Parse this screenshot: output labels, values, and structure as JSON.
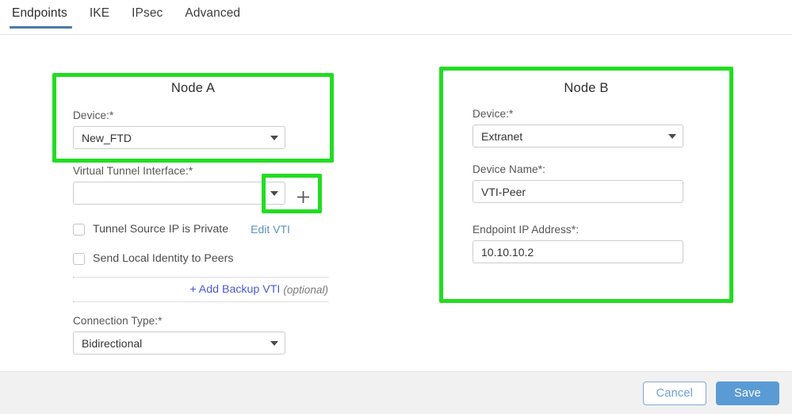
{
  "colors": {
    "tab_accent": "#4a7ba7",
    "highlight_green": "#22dd22",
    "link_blue": "#5b8fc9",
    "link_strong_blue": "#4a5bd0",
    "primary_button_bg": "#5b9bd5",
    "secondary_button_text": "#6c9fd8",
    "footer_bg": "#f1f1f1"
  },
  "tabs": [
    {
      "label": "Endpoints",
      "active": true
    },
    {
      "label": "IKE",
      "active": false
    },
    {
      "label": "IPsec",
      "active": false
    },
    {
      "label": "Advanced",
      "active": false
    }
  ],
  "node_a": {
    "title": "Node A",
    "device": {
      "label": "Device:*",
      "value": "New_FTD",
      "caret_icon": "chevron-down-icon"
    },
    "virtual_tunnel_interface": {
      "label": "Virtual Tunnel Interface:*",
      "value": "",
      "placeholder": "",
      "caret_icon": "chevron-down-icon",
      "add_icon": "plus-icon"
    },
    "checkboxes": [
      {
        "label": "Tunnel Source IP is Private",
        "checked": false
      },
      {
        "label": "Send Local Identity to Peers",
        "checked": false
      }
    ],
    "edit_vti_link": "Edit VTI",
    "backup_vti": {
      "link": "+ Add Backup VTI",
      "optional": "(optional)"
    },
    "connection_type": {
      "label": "Connection Type:*",
      "value": "Bidirectional",
      "caret_icon": "chevron-down-icon"
    }
  },
  "node_b": {
    "title": "Node B",
    "device": {
      "label": "Device:*",
      "value": "Extranet",
      "caret_icon": "chevron-down-icon"
    },
    "device_name": {
      "label": "Device Name*:",
      "value": "VTI-Peer"
    },
    "endpoint_ip": {
      "label": "Endpoint IP Address*:",
      "value": "10.10.10.2"
    }
  },
  "footer": {
    "cancel_label": "Cancel",
    "save_label": "Save"
  }
}
